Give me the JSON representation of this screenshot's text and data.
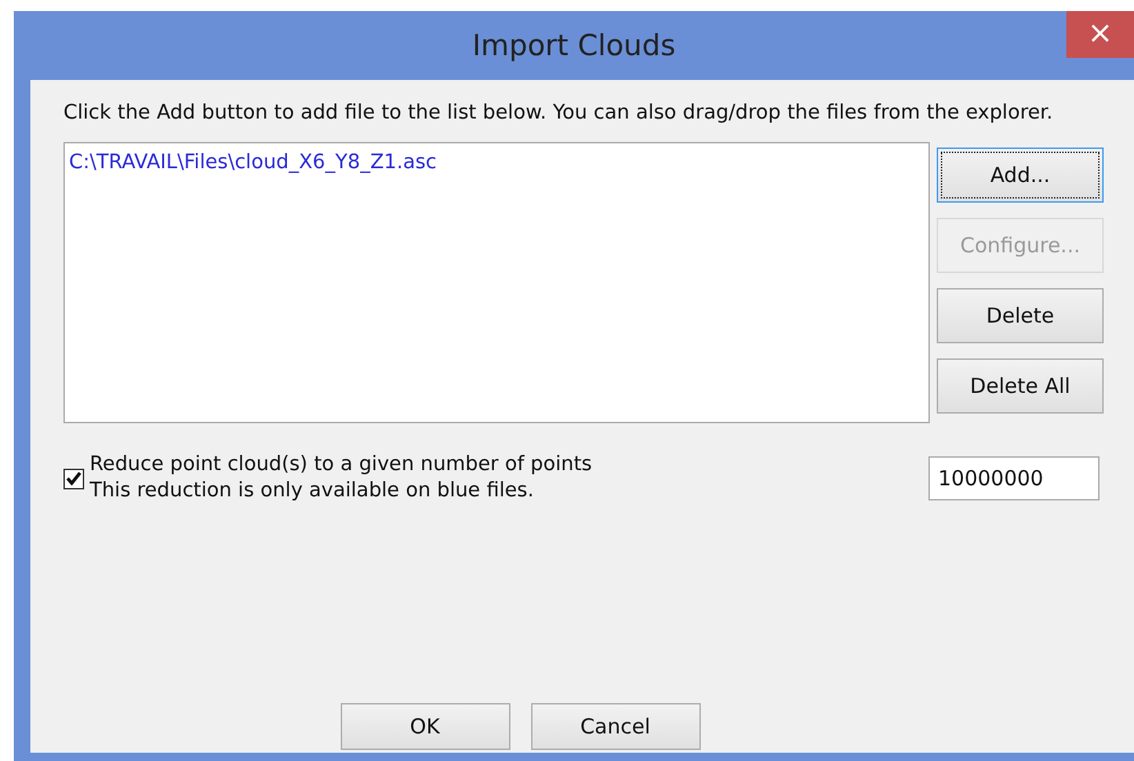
{
  "window": {
    "title": "Import Clouds",
    "close": "×"
  },
  "instructions": "Click the Add button to add file to the list below. You can also drag/drop the files from the explorer.",
  "files": [
    {
      "path": "C:\\TRAVAIL\\Files\\cloud_X6_Y8_Z1.asc",
      "color": "#2a2ad8"
    }
  ],
  "side_buttons": [
    {
      "label": "Add...",
      "disabled": false,
      "focused": true
    },
    {
      "label": "Configure...",
      "disabled": true,
      "focused": false
    },
    {
      "label": "Delete",
      "disabled": false,
      "focused": false
    },
    {
      "label": "Delete All",
      "disabled": false,
      "focused": false
    }
  ],
  "reduce": {
    "checked": true,
    "label": "Reduce point cloud(s) to a given number of points",
    "note": "This reduction is only available on blue files.",
    "value": "10000000"
  },
  "buttons": [
    "OK",
    "Cancel"
  ]
}
